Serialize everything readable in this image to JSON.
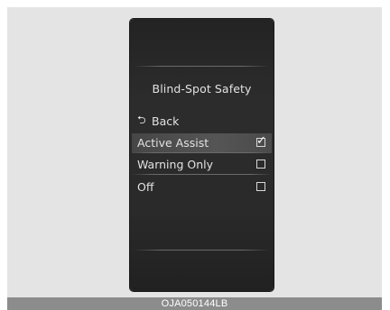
{
  "screen": {
    "title": "Blind-Spot Safety",
    "back": {
      "icon": "return-arrow-icon",
      "glyph": "⮌",
      "label": "Back"
    },
    "options": [
      {
        "label": "Active Assist",
        "checked": true,
        "checkmark": "✓"
      },
      {
        "label": "Warning Only",
        "checked": false
      },
      {
        "label": "Off",
        "checked": false
      }
    ]
  },
  "caption": "OJA050144LB",
  "colors": {
    "background": "#e4e4e4",
    "screen": "#2a2a2a",
    "text": "#e2e2e2",
    "highlight": "#505050",
    "caption_bar": "#8c8c8c"
  }
}
